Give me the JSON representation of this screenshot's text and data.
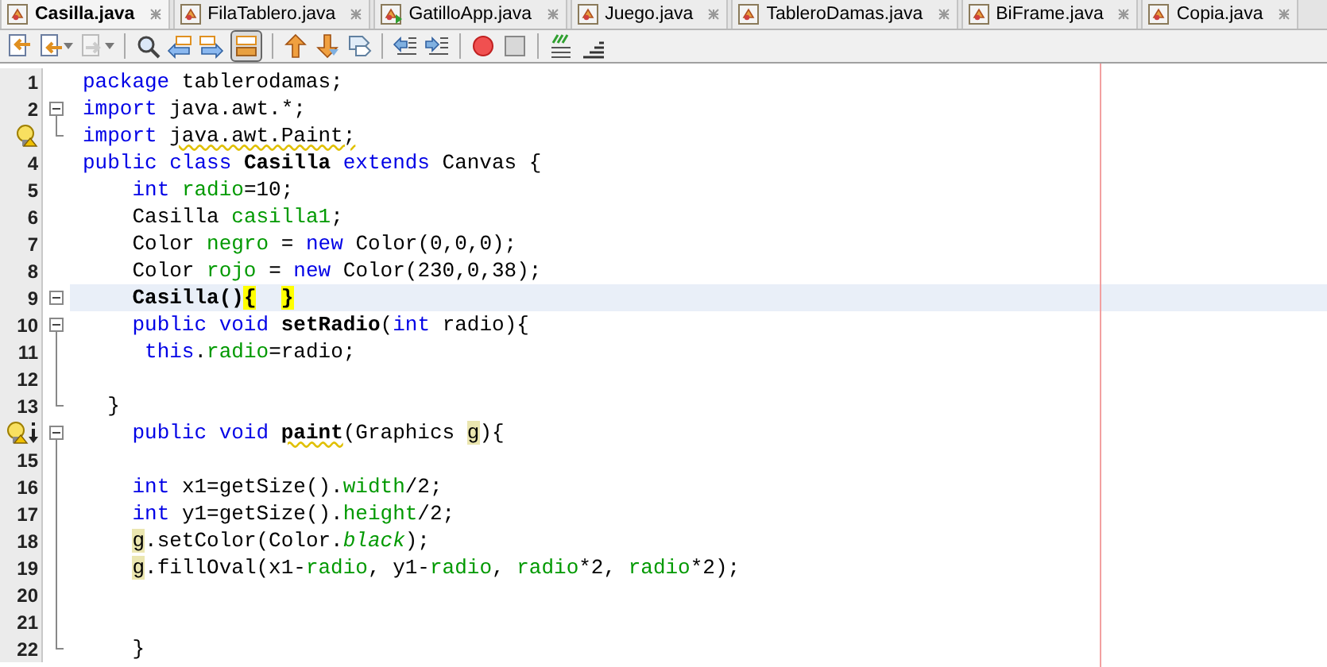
{
  "tabs": [
    {
      "label": "Casilla.java",
      "kind": "class",
      "selected": true
    },
    {
      "label": "FilaTablero.java",
      "kind": "class",
      "selected": false
    },
    {
      "label": "GatilloApp.java",
      "kind": "main",
      "selected": false
    },
    {
      "label": "Juego.java",
      "kind": "class",
      "selected": false
    },
    {
      "label": "TableroDamas.java",
      "kind": "class",
      "selected": false
    },
    {
      "label": "BiFrame.java",
      "kind": "class",
      "selected": false
    },
    {
      "label": "Copia.java",
      "kind": "class",
      "selected": false
    }
  ],
  "toolbar": [
    {
      "kind": "last-edit",
      "pressed": false
    },
    {
      "kind": "doc-prev",
      "pressed": false
    },
    {
      "kind": "doc-next-disabled",
      "pressed": false
    },
    {
      "kind": "separator"
    },
    {
      "kind": "find",
      "pressed": false
    },
    {
      "kind": "prev-occurrence",
      "pressed": false
    },
    {
      "kind": "next-occurrence",
      "pressed": false
    },
    {
      "kind": "highlight",
      "pressed": true
    },
    {
      "kind": "separator"
    },
    {
      "kind": "up",
      "pressed": false
    },
    {
      "kind": "down",
      "pressed": false
    },
    {
      "kind": "bookmark",
      "pressed": false
    },
    {
      "kind": "separator"
    },
    {
      "kind": "shift-left",
      "pressed": false
    },
    {
      "kind": "shift-right",
      "pressed": false
    },
    {
      "kind": "separator"
    },
    {
      "kind": "record",
      "pressed": false
    },
    {
      "kind": "stop",
      "pressed": false
    },
    {
      "kind": "separator"
    },
    {
      "kind": "comment",
      "pressed": false
    },
    {
      "kind": "uncomment",
      "pressed": false
    }
  ],
  "editor": {
    "lines": [
      {
        "number": "1",
        "current": false,
        "tokens": [
          {
            "text": "package",
            "kind": "kw"
          },
          {
            "text": " tablerodamas;",
            "kind": "p"
          }
        ]
      },
      {
        "number": "2",
        "fold": {
          "kind": "start"
        },
        "current": false,
        "tokens": [
          {
            "text": "import",
            "kind": "kw"
          },
          {
            "text": " java.awt.*;",
            "kind": "p"
          }
        ]
      },
      {
        "hint": {
          "kind": "bulb"
        },
        "fold": {
          "kind": "end"
        },
        "current": false,
        "tokens": [
          {
            "text": "import",
            "kind": "kw"
          },
          {
            "text": " java.awt.Paint;",
            "kind": "warn"
          }
        ]
      },
      {
        "number": "4",
        "current": false,
        "tokens": [
          {
            "text": "public class",
            "kind": "kw"
          },
          {
            "text": " Casilla",
            "kind": "decl"
          },
          {
            "text": " extends",
            "kind": "kw"
          },
          {
            "text": " Canvas {",
            "kind": "p"
          }
        ]
      },
      {
        "number": "5",
        "current": false,
        "tokens": [
          {
            "text": "    int",
            "kind": "kw"
          },
          {
            "text": " radio",
            "kind": "field"
          },
          {
            "text": "=10;",
            "kind": "p"
          }
        ]
      },
      {
        "number": "6",
        "current": false,
        "tokens": [
          {
            "text": "    Casilla ",
            "kind": "p"
          },
          {
            "text": "casilla1",
            "kind": "field"
          },
          {
            "text": ";",
            "kind": "p"
          }
        ]
      },
      {
        "number": "7",
        "current": false,
        "tokens": [
          {
            "text": "    Color ",
            "kind": "p"
          },
          {
            "text": "negro",
            "kind": "field"
          },
          {
            "text": " = ",
            "kind": "p"
          },
          {
            "text": "new",
            "kind": "kw"
          },
          {
            "text": " Color(0,0,0);",
            "kind": "p"
          }
        ]
      },
      {
        "number": "8",
        "current": false,
        "tokens": [
          {
            "text": "    Color ",
            "kind": "p"
          },
          {
            "text": "rojo",
            "kind": "field"
          },
          {
            "text": " = ",
            "kind": "p"
          },
          {
            "text": "new",
            "kind": "kw"
          },
          {
            "text": " Color(230,0,38);",
            "kind": "p"
          }
        ]
      },
      {
        "number": "9",
        "fold": {
          "kind": "single"
        },
        "current": true,
        "tokens": [
          {
            "text": "    Casilla()",
            "kind": "decl"
          },
          {
            "text": "{",
            "kind": "match"
          },
          {
            "text": "  }",
            "kind": "match"
          }
        ]
      },
      {
        "number": "10",
        "fold": {
          "kind": "start"
        },
        "current": false,
        "tokens": [
          {
            "text": "    public void",
            "kind": "kw"
          },
          {
            "text": " setRadio",
            "kind": "decl"
          },
          {
            "text": "(",
            "kind": "p"
          },
          {
            "text": "int",
            "kind": "kw"
          },
          {
            "text": " radio){",
            "kind": "p"
          }
        ]
      },
      {
        "number": "11",
        "fold": {
          "kind": "line"
        },
        "current": false,
        "tokens": [
          {
            "text": "     this",
            "kind": "kw"
          },
          {
            "text": ".",
            "kind": "p"
          },
          {
            "text": "radio",
            "kind": "field"
          },
          {
            "text": "=radio;",
            "kind": "p"
          }
        ]
      },
      {
        "number": "12",
        "fold": {
          "kind": "line"
        },
        "current": false
      },
      {
        "number": "13",
        "fold": {
          "kind": "end"
        },
        "current": false,
        "tokens": [
          {
            "text": "  }",
            "kind": "p"
          }
        ]
      },
      {
        "hint": {
          "kind": "bulb-override"
        },
        "fold": {
          "kind": "start"
        },
        "current": false,
        "tokens": [
          {
            "text": "    public void",
            "kind": "kw"
          },
          {
            "text": " paint",
            "kind": "decl-warn"
          },
          {
            "text": "(Graphics ",
            "kind": "p"
          },
          {
            "text": "g",
            "kind": "mark"
          },
          {
            "text": "){",
            "kind": "p"
          }
        ]
      },
      {
        "number": "15",
        "fold": {
          "kind": "line"
        },
        "current": false
      },
      {
        "number": "16",
        "fold": {
          "kind": "line"
        },
        "current": false,
        "tokens": [
          {
            "text": "    int",
            "kind": "kw"
          },
          {
            "text": " x1=getSize().",
            "kind": "p"
          },
          {
            "text": "width",
            "kind": "field"
          },
          {
            "text": "/2;",
            "kind": "p"
          }
        ]
      },
      {
        "number": "17",
        "fold": {
          "kind": "line"
        },
        "current": false,
        "tokens": [
          {
            "text": "    int",
            "kind": "kw"
          },
          {
            "text": " y1=getSize().",
            "kind": "p"
          },
          {
            "text": "height",
            "kind": "field"
          },
          {
            "text": "/2;",
            "kind": "p"
          }
        ]
      },
      {
        "number": "18",
        "fold": {
          "kind": "line"
        },
        "current": false,
        "tokens": [
          {
            "text": "    g",
            "kind": "mark"
          },
          {
            "text": ".setColor(Color.",
            "kind": "p"
          },
          {
            "text": "black",
            "kind": "static"
          },
          {
            "text": ");",
            "kind": "p"
          }
        ]
      },
      {
        "number": "19",
        "fold": {
          "kind": "line"
        },
        "current": false,
        "tokens": [
          {
            "text": "    g",
            "kind": "mark"
          },
          {
            "text": ".fillOval(x1-",
            "kind": "p"
          },
          {
            "text": "radio",
            "kind": "field"
          },
          {
            "text": ", y1-",
            "kind": "p"
          },
          {
            "text": "radio",
            "kind": "field"
          },
          {
            "text": ", ",
            "kind": "p"
          },
          {
            "text": "radio",
            "kind": "field"
          },
          {
            "text": "*2, ",
            "kind": "p"
          },
          {
            "text": "radio",
            "kind": "field"
          },
          {
            "text": "*2);",
            "kind": "p"
          }
        ]
      },
      {
        "number": "20",
        "fold": {
          "kind": "line"
        },
        "current": false
      },
      {
        "number": "21",
        "fold": {
          "kind": "line"
        },
        "current": false
      },
      {
        "number": "22",
        "fold": {
          "kind": "end"
        },
        "current": false,
        "tokens": [
          {
            "text": "    }",
            "kind": "p"
          }
        ]
      }
    ]
  }
}
